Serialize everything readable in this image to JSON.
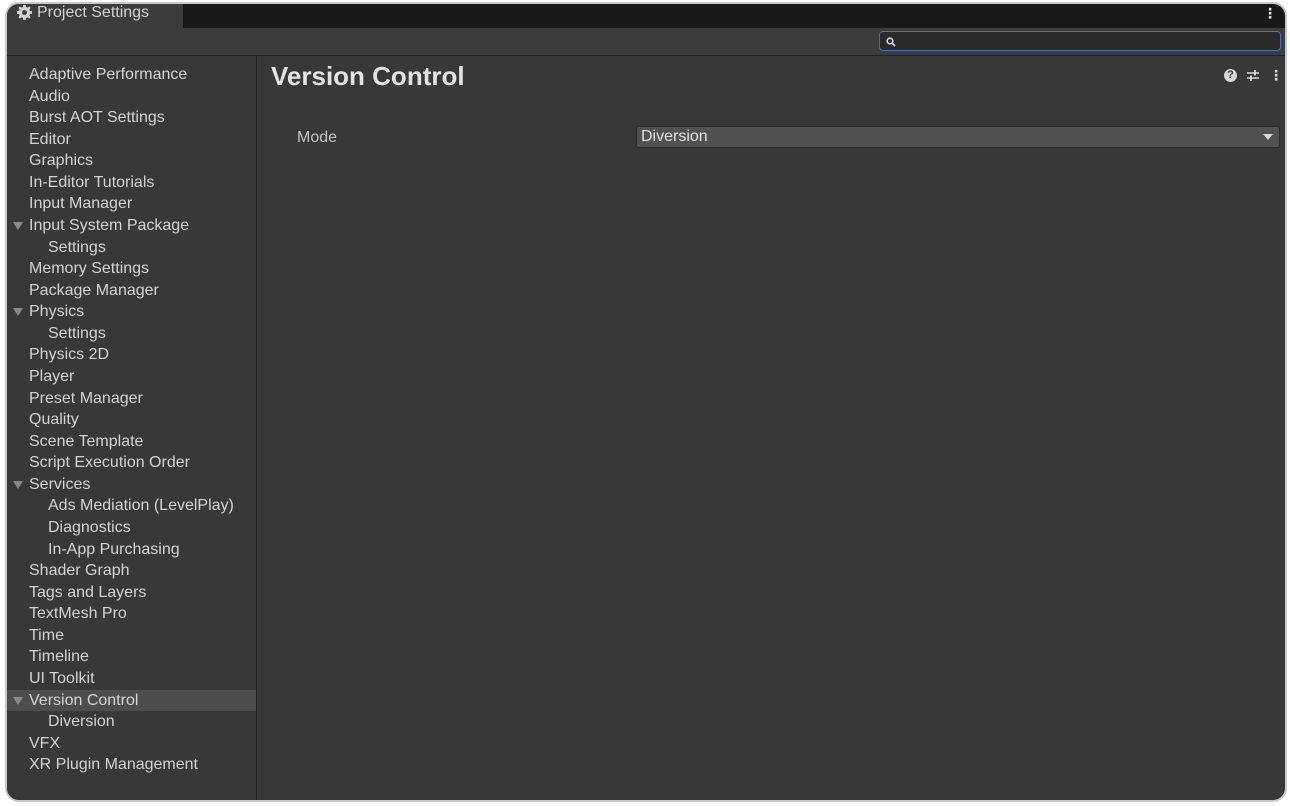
{
  "window": {
    "tab_title": "Project Settings"
  },
  "search": {
    "value": "",
    "placeholder": ""
  },
  "sidebar": {
    "items": [
      {
        "label": "Adaptive Performance",
        "level": 0,
        "expandable": false,
        "selected": false
      },
      {
        "label": "Audio",
        "level": 0,
        "expandable": false,
        "selected": false
      },
      {
        "label": "Burst AOT Settings",
        "level": 0,
        "expandable": false,
        "selected": false
      },
      {
        "label": "Editor",
        "level": 0,
        "expandable": false,
        "selected": false
      },
      {
        "label": "Graphics",
        "level": 0,
        "expandable": false,
        "selected": false
      },
      {
        "label": "In-Editor Tutorials",
        "level": 0,
        "expandable": false,
        "selected": false
      },
      {
        "label": "Input Manager",
        "level": 0,
        "expandable": false,
        "selected": false
      },
      {
        "label": "Input System Package",
        "level": 0,
        "expandable": true,
        "selected": false
      },
      {
        "label": "Settings",
        "level": 1,
        "expandable": false,
        "selected": false
      },
      {
        "label": "Memory Settings",
        "level": 0,
        "expandable": false,
        "selected": false
      },
      {
        "label": "Package Manager",
        "level": 0,
        "expandable": false,
        "selected": false
      },
      {
        "label": "Physics",
        "level": 0,
        "expandable": true,
        "selected": false
      },
      {
        "label": "Settings",
        "level": 1,
        "expandable": false,
        "selected": false
      },
      {
        "label": "Physics 2D",
        "level": 0,
        "expandable": false,
        "selected": false
      },
      {
        "label": "Player",
        "level": 0,
        "expandable": false,
        "selected": false
      },
      {
        "label": "Preset Manager",
        "level": 0,
        "expandable": false,
        "selected": false
      },
      {
        "label": "Quality",
        "level": 0,
        "expandable": false,
        "selected": false
      },
      {
        "label": "Scene Template",
        "level": 0,
        "expandable": false,
        "selected": false
      },
      {
        "label": "Script Execution Order",
        "level": 0,
        "expandable": false,
        "selected": false
      },
      {
        "label": "Services",
        "level": 0,
        "expandable": true,
        "selected": false
      },
      {
        "label": "Ads Mediation (LevelPlay)",
        "level": 1,
        "expandable": false,
        "selected": false
      },
      {
        "label": "Diagnostics",
        "level": 1,
        "expandable": false,
        "selected": false
      },
      {
        "label": "In-App Purchasing",
        "level": 1,
        "expandable": false,
        "selected": false
      },
      {
        "label": "Shader Graph",
        "level": 0,
        "expandable": false,
        "selected": false
      },
      {
        "label": "Tags and Layers",
        "level": 0,
        "expandable": false,
        "selected": false
      },
      {
        "label": "TextMesh Pro",
        "level": 0,
        "expandable": false,
        "selected": false
      },
      {
        "label": "Time",
        "level": 0,
        "expandable": false,
        "selected": false
      },
      {
        "label": "Timeline",
        "level": 0,
        "expandable": false,
        "selected": false
      },
      {
        "label": "UI Toolkit",
        "level": 0,
        "expandable": false,
        "selected": false
      },
      {
        "label": "Version Control",
        "level": 0,
        "expandable": true,
        "selected": true
      },
      {
        "label": "Diversion",
        "level": 1,
        "expandable": false,
        "selected": false
      },
      {
        "label": "VFX",
        "level": 0,
        "expandable": false,
        "selected": false
      },
      {
        "label": "XR Plugin Management",
        "level": 0,
        "expandable": false,
        "selected": false
      }
    ]
  },
  "main": {
    "title": "Version Control",
    "mode_label": "Mode",
    "mode_value": "Diversion"
  },
  "icons": {
    "tab": "gear-icon",
    "search": "search-icon",
    "help": "help-icon",
    "presets": "sliders-icon",
    "menu": "more-vertical-icon"
  },
  "colors": {
    "background": "#383838",
    "selected_row": "#4d4d4d",
    "search_focus_border": "#3a79bb",
    "text": "#d4d4d4"
  }
}
